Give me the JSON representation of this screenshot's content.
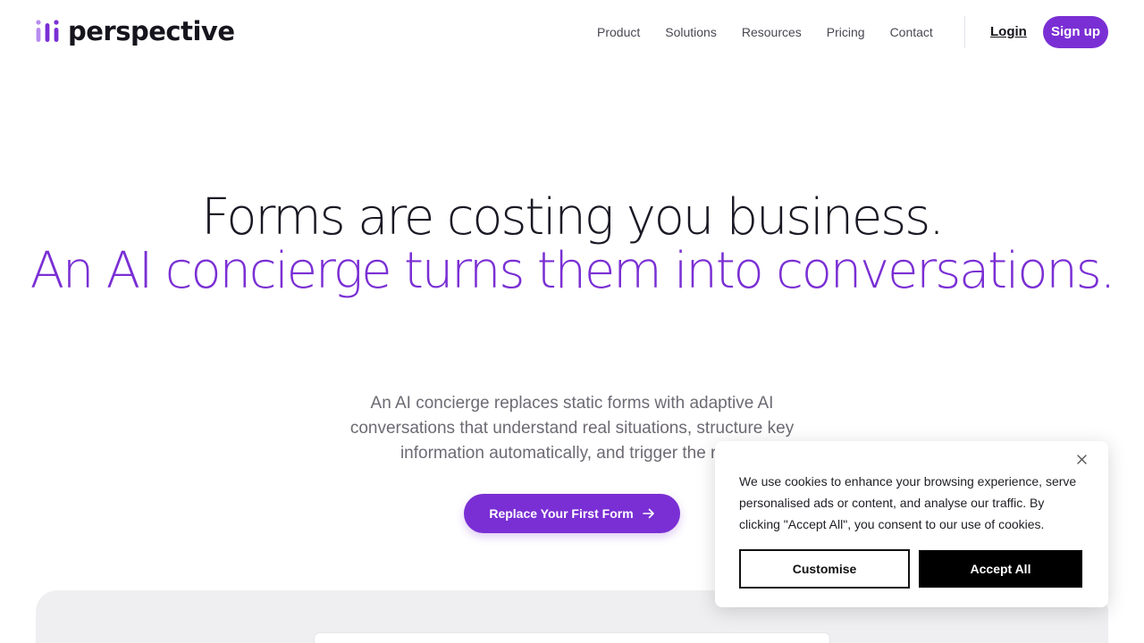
{
  "header": {
    "logo_text": "perspective",
    "nav": [
      "Product",
      "Solutions",
      "Resources",
      "Pricing",
      "Contact"
    ],
    "login_label": "Login",
    "signup_label": "Sign up"
  },
  "hero": {
    "title_line1": "Forms are costing you business.",
    "title_line2": "An AI concierge turns them into conversations.",
    "subtitle": "An AI concierge replaces static forms with adaptive AI conversations that understand real situations, structure key information automatically, and trigger the right",
    "cta_label": "Replace Your First Form"
  },
  "cookie_banner": {
    "text": "We use cookies to enhance your browsing experience, serve personalised ads or content, and analyse our traffic. By clicking \"Accept All\", you consent to our use of cookies.",
    "customise_label": "Customise",
    "accept_label": "Accept All"
  },
  "colors": {
    "brand": "#7a2fd4",
    "text": "#16141c",
    "muted": "#6d6a73"
  },
  "icons": {
    "logo": "perspective-logo-icon",
    "cta_arrow": "arrow-right-icon",
    "cookie_close": "close-icon"
  }
}
